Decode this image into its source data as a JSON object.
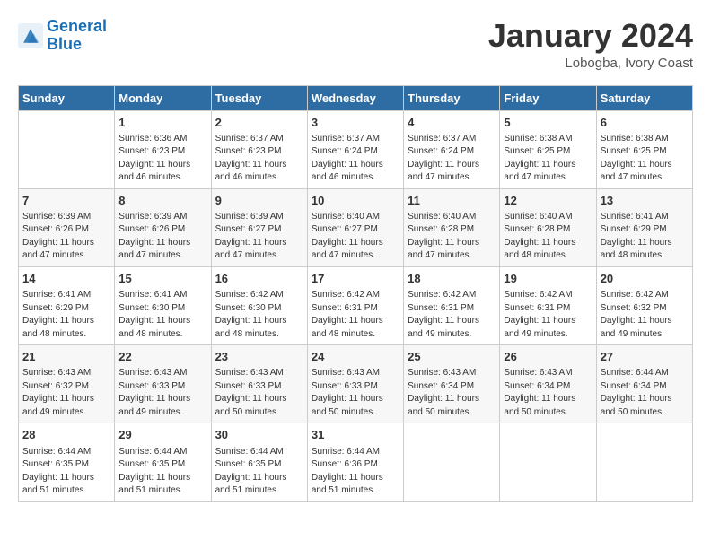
{
  "header": {
    "logo_line1": "General",
    "logo_line2": "Blue",
    "month_year": "January 2024",
    "location": "Lobogba, Ivory Coast"
  },
  "days_of_week": [
    "Sunday",
    "Monday",
    "Tuesday",
    "Wednesday",
    "Thursday",
    "Friday",
    "Saturday"
  ],
  "weeks": [
    [
      {
        "day": "",
        "info": ""
      },
      {
        "day": "1",
        "info": "Sunrise: 6:36 AM\nSunset: 6:23 PM\nDaylight: 11 hours\nand 46 minutes."
      },
      {
        "day": "2",
        "info": "Sunrise: 6:37 AM\nSunset: 6:23 PM\nDaylight: 11 hours\nand 46 minutes."
      },
      {
        "day": "3",
        "info": "Sunrise: 6:37 AM\nSunset: 6:24 PM\nDaylight: 11 hours\nand 46 minutes."
      },
      {
        "day": "4",
        "info": "Sunrise: 6:37 AM\nSunset: 6:24 PM\nDaylight: 11 hours\nand 47 minutes."
      },
      {
        "day": "5",
        "info": "Sunrise: 6:38 AM\nSunset: 6:25 PM\nDaylight: 11 hours\nand 47 minutes."
      },
      {
        "day": "6",
        "info": "Sunrise: 6:38 AM\nSunset: 6:25 PM\nDaylight: 11 hours\nand 47 minutes."
      }
    ],
    [
      {
        "day": "7",
        "info": "Sunrise: 6:39 AM\nSunset: 6:26 PM\nDaylight: 11 hours\nand 47 minutes."
      },
      {
        "day": "8",
        "info": "Sunrise: 6:39 AM\nSunset: 6:26 PM\nDaylight: 11 hours\nand 47 minutes."
      },
      {
        "day": "9",
        "info": "Sunrise: 6:39 AM\nSunset: 6:27 PM\nDaylight: 11 hours\nand 47 minutes."
      },
      {
        "day": "10",
        "info": "Sunrise: 6:40 AM\nSunset: 6:27 PM\nDaylight: 11 hours\nand 47 minutes."
      },
      {
        "day": "11",
        "info": "Sunrise: 6:40 AM\nSunset: 6:28 PM\nDaylight: 11 hours\nand 47 minutes."
      },
      {
        "day": "12",
        "info": "Sunrise: 6:40 AM\nSunset: 6:28 PM\nDaylight: 11 hours\nand 48 minutes."
      },
      {
        "day": "13",
        "info": "Sunrise: 6:41 AM\nSunset: 6:29 PM\nDaylight: 11 hours\nand 48 minutes."
      }
    ],
    [
      {
        "day": "14",
        "info": "Sunrise: 6:41 AM\nSunset: 6:29 PM\nDaylight: 11 hours\nand 48 minutes."
      },
      {
        "day": "15",
        "info": "Sunrise: 6:41 AM\nSunset: 6:30 PM\nDaylight: 11 hours\nand 48 minutes."
      },
      {
        "day": "16",
        "info": "Sunrise: 6:42 AM\nSunset: 6:30 PM\nDaylight: 11 hours\nand 48 minutes."
      },
      {
        "day": "17",
        "info": "Sunrise: 6:42 AM\nSunset: 6:31 PM\nDaylight: 11 hours\nand 48 minutes."
      },
      {
        "day": "18",
        "info": "Sunrise: 6:42 AM\nSunset: 6:31 PM\nDaylight: 11 hours\nand 49 minutes."
      },
      {
        "day": "19",
        "info": "Sunrise: 6:42 AM\nSunset: 6:31 PM\nDaylight: 11 hours\nand 49 minutes."
      },
      {
        "day": "20",
        "info": "Sunrise: 6:42 AM\nSunset: 6:32 PM\nDaylight: 11 hours\nand 49 minutes."
      }
    ],
    [
      {
        "day": "21",
        "info": "Sunrise: 6:43 AM\nSunset: 6:32 PM\nDaylight: 11 hours\nand 49 minutes."
      },
      {
        "day": "22",
        "info": "Sunrise: 6:43 AM\nSunset: 6:33 PM\nDaylight: 11 hours\nand 49 minutes."
      },
      {
        "day": "23",
        "info": "Sunrise: 6:43 AM\nSunset: 6:33 PM\nDaylight: 11 hours\nand 50 minutes."
      },
      {
        "day": "24",
        "info": "Sunrise: 6:43 AM\nSunset: 6:33 PM\nDaylight: 11 hours\nand 50 minutes."
      },
      {
        "day": "25",
        "info": "Sunrise: 6:43 AM\nSunset: 6:34 PM\nDaylight: 11 hours\nand 50 minutes."
      },
      {
        "day": "26",
        "info": "Sunrise: 6:43 AM\nSunset: 6:34 PM\nDaylight: 11 hours\nand 50 minutes."
      },
      {
        "day": "27",
        "info": "Sunrise: 6:44 AM\nSunset: 6:34 PM\nDaylight: 11 hours\nand 50 minutes."
      }
    ],
    [
      {
        "day": "28",
        "info": "Sunrise: 6:44 AM\nSunset: 6:35 PM\nDaylight: 11 hours\nand 51 minutes."
      },
      {
        "day": "29",
        "info": "Sunrise: 6:44 AM\nSunset: 6:35 PM\nDaylight: 11 hours\nand 51 minutes."
      },
      {
        "day": "30",
        "info": "Sunrise: 6:44 AM\nSunset: 6:35 PM\nDaylight: 11 hours\nand 51 minutes."
      },
      {
        "day": "31",
        "info": "Sunrise: 6:44 AM\nSunset: 6:36 PM\nDaylight: 11 hours\nand 51 minutes."
      },
      {
        "day": "",
        "info": ""
      },
      {
        "day": "",
        "info": ""
      },
      {
        "day": "",
        "info": ""
      }
    ]
  ]
}
